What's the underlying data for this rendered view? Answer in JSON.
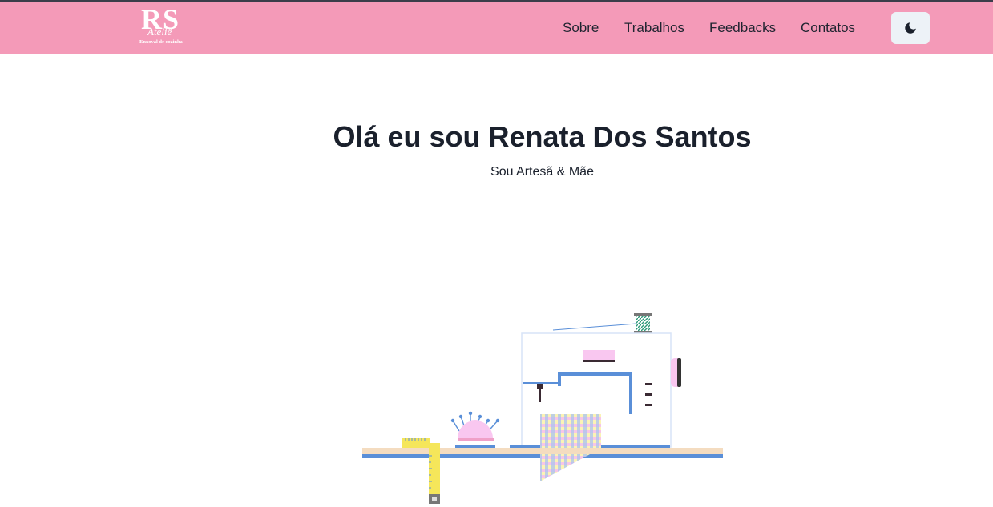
{
  "header": {
    "logo": {
      "monogram": "RS",
      "name": "Ateliê",
      "tagline": "Enxoval de cozinha"
    },
    "nav": [
      {
        "label": "Sobre"
      },
      {
        "label": "Trabalhos"
      },
      {
        "label": "Feedbacks"
      },
      {
        "label": "Contatos"
      }
    ],
    "theme_toggle_icon": "moon-icon"
  },
  "hero": {
    "title": "Olá eu sou Renata Dos Santos",
    "subtitle": "Sou Artesã & Mãe"
  },
  "illustration": {
    "subject": "sewing-machine-illustration"
  },
  "colors": {
    "navbar_bg": "#f49ab8",
    "toggle_bg": "#edf2f7",
    "accent_blue": "#5a8fd8",
    "accent_pink": "#f9c7f0",
    "text_dark": "#1a202c"
  }
}
